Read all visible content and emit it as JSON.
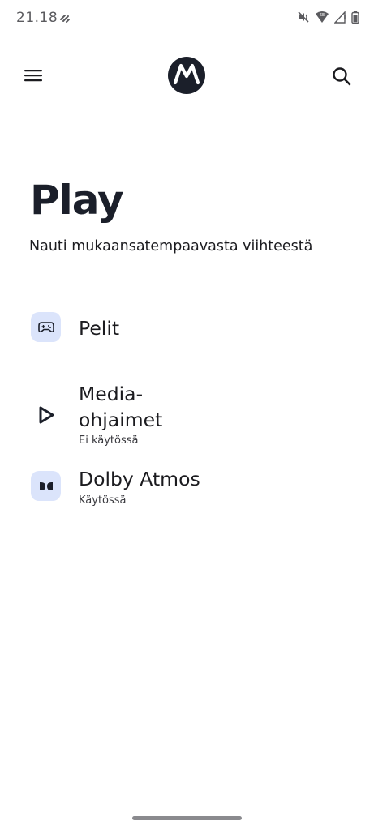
{
  "status_bar": {
    "time": "21.18",
    "icons": [
      "app-notification-icon",
      "mute-icon",
      "wifi-6e-icon",
      "signal-icon",
      "battery-icon"
    ]
  },
  "app_bar": {
    "menu_icon": "hamburger-menu-icon",
    "logo": "motorola-logo",
    "search_icon": "search-icon"
  },
  "header": {
    "title": "Play",
    "subtitle": "Nauti mukaansatempaavasta viihteestä"
  },
  "items": [
    {
      "title": "Pelit",
      "summary": "",
      "icon": "gamepad-icon"
    },
    {
      "title": "Media-ohjaimet",
      "summary": "Ei käytössä",
      "icon": "play-triangle-icon"
    },
    {
      "title": "Dolby Atmos",
      "summary": "Käytössä",
      "icon": "dolby-icon"
    }
  ],
  "colors": {
    "icon_bg": "#dbe4fb",
    "title": "#1b1f2a",
    "logo_bg": "#1b1f2a"
  }
}
